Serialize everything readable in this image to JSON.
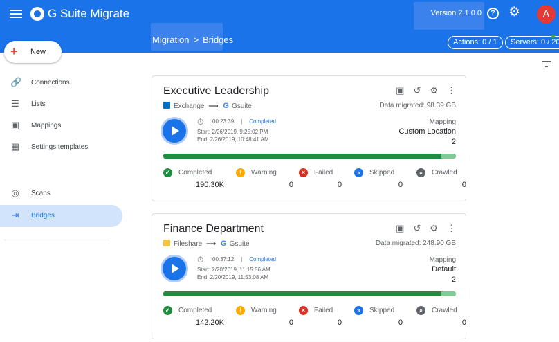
{
  "app": {
    "title": "G Suite Migrate",
    "version": "Version 2.1.0.0",
    "avatar_letter": "A"
  },
  "breadcrumb": {
    "root": "Migration",
    "separator": ">",
    "current": "Bridges"
  },
  "header_pills": {
    "actions": "Actions: 0 / 1",
    "servers": "Servers: 0 / 20"
  },
  "new_button": {
    "label": "New"
  },
  "sidebar": {
    "items": [
      {
        "label": "Connections",
        "icon": "link-icon"
      },
      {
        "label": "Lists",
        "icon": "list-icon"
      },
      {
        "label": "Mappings",
        "icon": "map-icon"
      },
      {
        "label": "Settings templates",
        "icon": "template-icon"
      },
      {
        "label": "Scans",
        "icon": "scan-icon"
      },
      {
        "label": "Bridges",
        "icon": "bridge-icon",
        "active": true
      }
    ]
  },
  "cards": [
    {
      "title": "Executive Leadership",
      "source": "Exchange",
      "source_icon": "exchange-icon",
      "target": "Gsuite",
      "data_migrated": "Data migrated: 98.39 GB",
      "duration": "00:23:39",
      "status": "Completed",
      "start": "Start:  2/26/2019, 9:25:02 PM",
      "end": "End:   2/26/2019, 10:48:41 AM",
      "mapping_label": "Mapping",
      "mapping_value": "Custom Location",
      "mapping_count": "2",
      "progress": 0.95,
      "stats": [
        {
          "label": "Completed",
          "value": "190.30K",
          "color": "#1e8e3e",
          "icon": "check-circle-icon"
        },
        {
          "label": "Warning",
          "value": "0",
          "color": "#f9ab00",
          "icon": "warning-icon"
        },
        {
          "label": "Failed",
          "value": "0",
          "color": "#d93025",
          "icon": "error-icon"
        },
        {
          "label": "Skipped",
          "value": "0",
          "color": "#1a73e8",
          "icon": "skip-icon"
        },
        {
          "label": "Crawled",
          "value": "0",
          "color": "#5f6368",
          "icon": "search-icon"
        }
      ]
    },
    {
      "title": "Finance Department",
      "source": "Fileshare",
      "source_icon": "folder-icon",
      "target": "Gsuite",
      "data_migrated": "Data migrated: 248.90 GB",
      "duration": "00:37:12",
      "status": "Completed",
      "start": "Start:  2/20/2019, 11:15:56 AM",
      "end": "End:   2/20/2019, 11:53:08 AM",
      "mapping_label": "Mapping",
      "mapping_value": "Default",
      "mapping_count": "2",
      "progress": 0.95,
      "stats": [
        {
          "label": "Completed",
          "value": "142.20K",
          "color": "#1e8e3e",
          "icon": "check-circle-icon"
        },
        {
          "label": "Warning",
          "value": "0",
          "color": "#f9ab00",
          "icon": "warning-icon"
        },
        {
          "label": "Failed",
          "value": "0",
          "color": "#d93025",
          "icon": "error-icon"
        },
        {
          "label": "Skipped",
          "value": "0",
          "color": "#1a73e8",
          "icon": "skip-icon"
        },
        {
          "label": "Crawled",
          "value": "0",
          "color": "#5f6368",
          "icon": "search-icon"
        }
      ]
    }
  ]
}
